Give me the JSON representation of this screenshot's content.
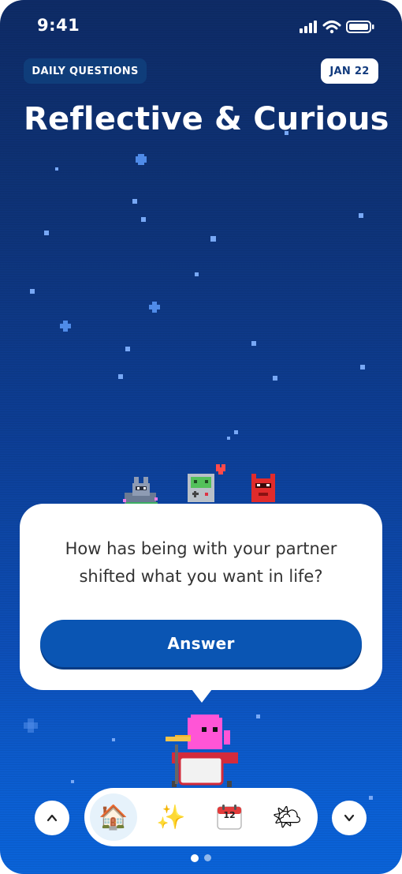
{
  "status_bar": {
    "time": "9:41"
  },
  "header": {
    "category_label": "DAILY QUESTIONS",
    "date_label": "JAN 22",
    "title": "Reflective & Curious"
  },
  "question_card": {
    "question": "How has being with your partner shifted what you want in life?",
    "answer_label": "Answer"
  },
  "tab_bar": {
    "tabs": [
      {
        "name": "home",
        "icon": "🏠",
        "active": true
      },
      {
        "name": "sparkles",
        "icon": "✨",
        "active": false
      },
      {
        "name": "calendar",
        "icon": "📅",
        "number": "12",
        "active": false
      },
      {
        "name": "weather",
        "icon": "🌤",
        "active": false
      }
    ]
  },
  "pagination": {
    "pages": 2,
    "current": 1
  },
  "colors": {
    "background_top": "#0e2b66",
    "background_bottom": "#0a63d8",
    "answer_button": "#0a55b3",
    "pill_dark": "#0f3d7a"
  }
}
